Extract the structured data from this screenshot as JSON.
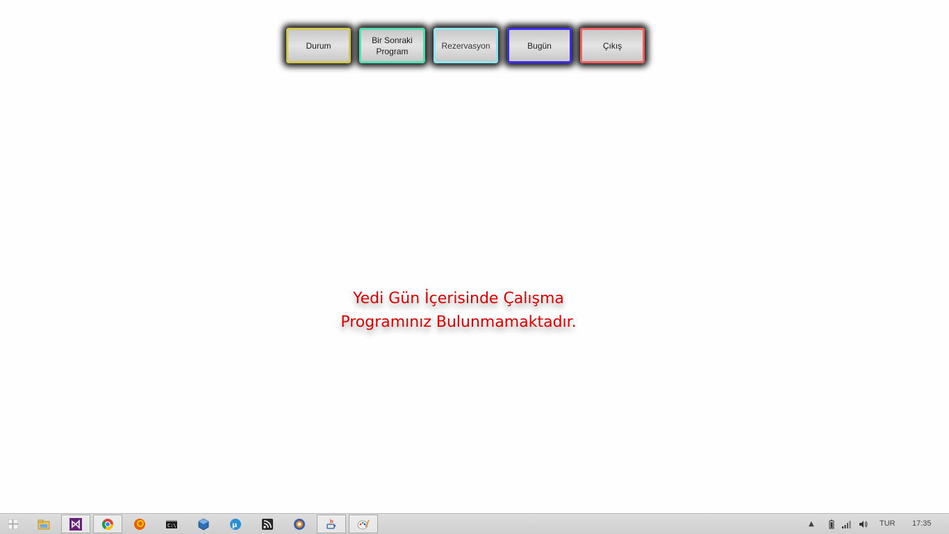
{
  "toolbar": {
    "buttons": [
      {
        "label": "Durum"
      },
      {
        "label": "Bir Sonraki\nProgram"
      },
      {
        "label": "Rezervasyon"
      },
      {
        "label": "Bugün"
      },
      {
        "label": "Çıkış"
      }
    ]
  },
  "main": {
    "message": "Yedi Gün İçerisinde Çalışma\nProgramınız Bulunmamaktadır."
  },
  "taskbar": {
    "apps": [
      {
        "icon": "windows-start-icon"
      },
      {
        "icon": "file-explorer-icon"
      },
      {
        "icon": "visual-studio-icon"
      },
      {
        "icon": "chrome-icon"
      },
      {
        "icon": "firefox-icon"
      },
      {
        "icon": "command-prompt-icon"
      },
      {
        "icon": "virtualbox-icon"
      },
      {
        "icon": "utorrent-icon"
      },
      {
        "icon": "rss-reader-icon"
      },
      {
        "icon": "browser-icon"
      },
      {
        "icon": "java-app-icon"
      },
      {
        "icon": "paint-icon"
      }
    ],
    "tray": {
      "language": "TUR",
      "time": "17:35"
    }
  }
}
